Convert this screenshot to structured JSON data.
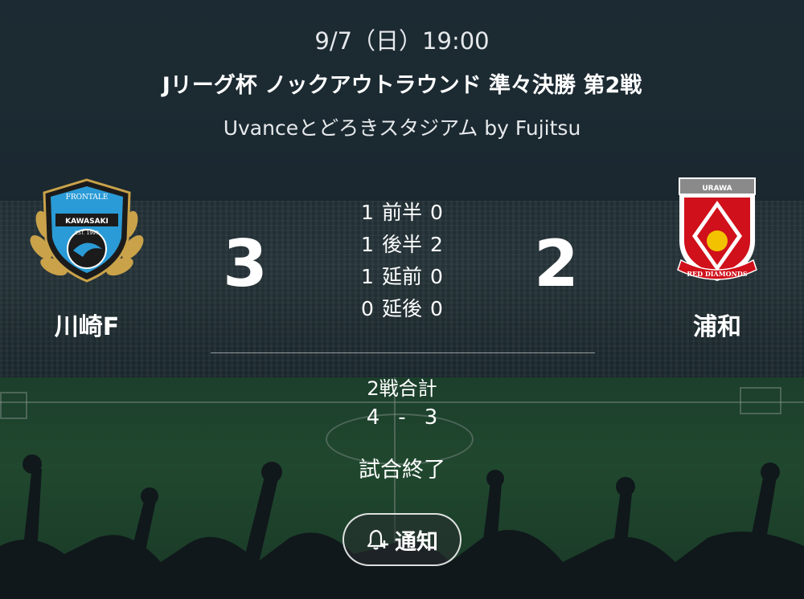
{
  "match": {
    "date_time": "9/7（日）19:00",
    "competition": "Jリーグ杯 ノックアウトラウンド 準々決勝 第2戦",
    "venue": "Uvanceとどろきスタジアム by Fujitsu"
  },
  "home_team": {
    "name": "川崎F",
    "score": "3",
    "crest_text": {
      "top": "FRONTALE",
      "middle": "KAWASAKI",
      "est": "EST. 1997"
    },
    "colors": {
      "primary": "#2a9bd6",
      "secondary": "#1b1b1b",
      "accent": "#c9a24a"
    }
  },
  "away_team": {
    "name": "浦和",
    "score": "2",
    "crest_text": {
      "top": "URAWA",
      "bottom": "RED DIAMONDS"
    },
    "colors": {
      "primary": "#d0101b",
      "accent": "#f2c200"
    }
  },
  "periods": [
    {
      "home": "1",
      "label": "前半",
      "away": "0"
    },
    {
      "home": "1",
      "label": "後半",
      "away": "2"
    },
    {
      "home": "1",
      "label": "延前",
      "away": "0"
    },
    {
      "home": "0",
      "label": "延後",
      "away": "0"
    }
  ],
  "aggregate": {
    "label": "2戦合計",
    "home": "4",
    "separator": "-",
    "away": "3"
  },
  "status": "試合終了",
  "notify_button": {
    "label": "通知",
    "icon": "bell-plus-icon"
  }
}
